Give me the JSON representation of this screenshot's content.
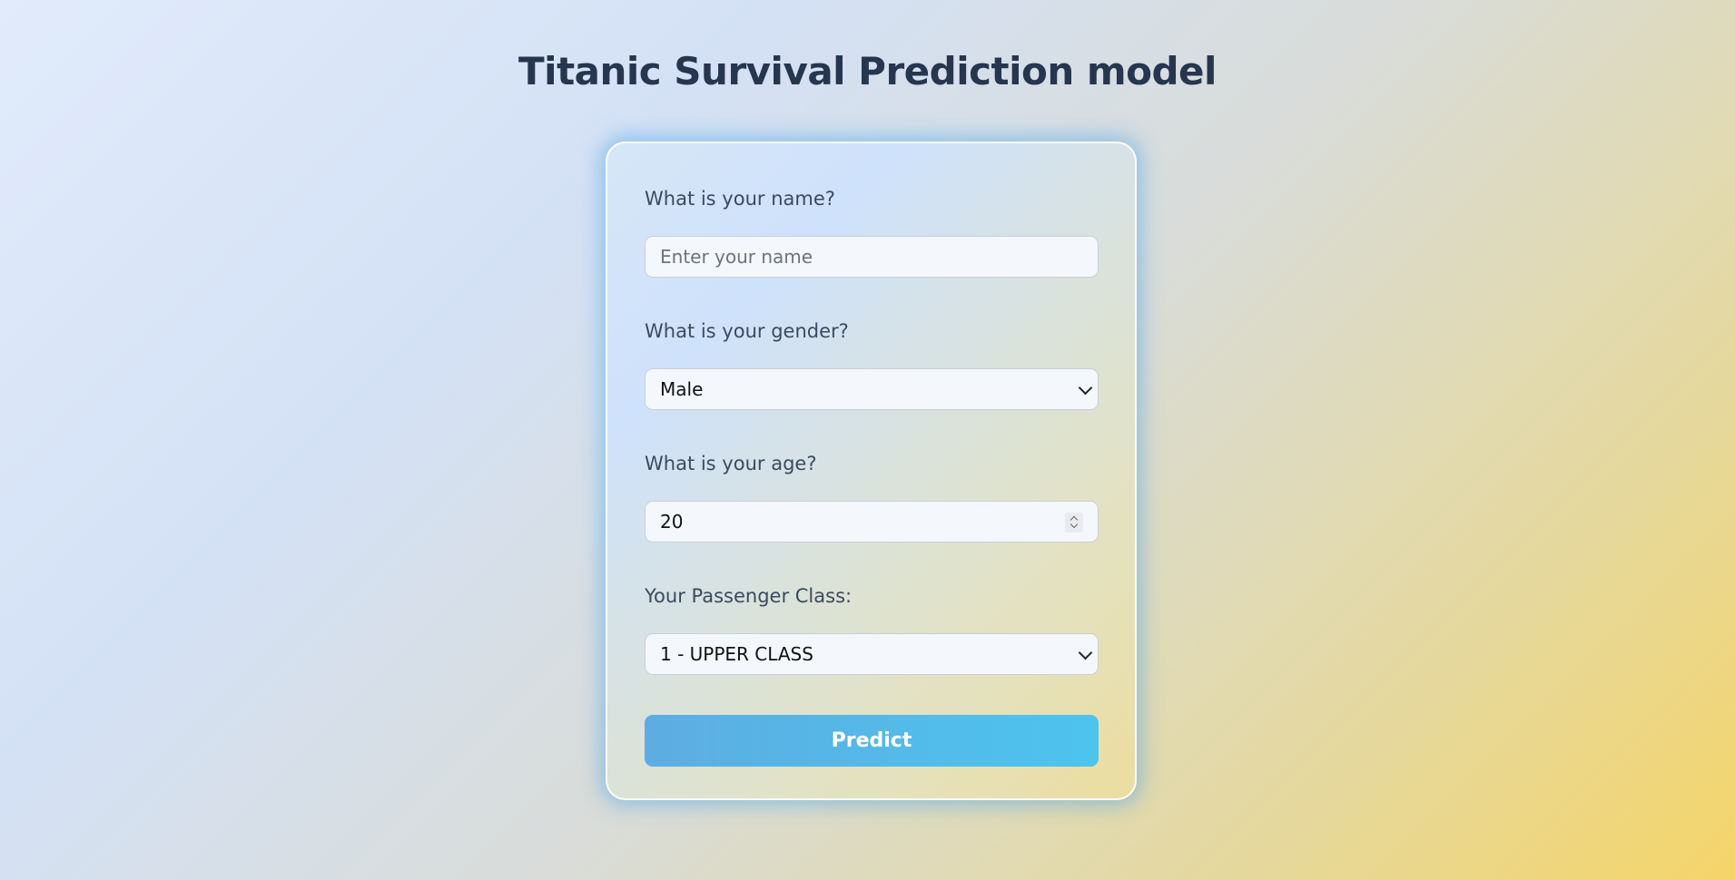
{
  "page": {
    "title": "Titanic Survival Prediction model"
  },
  "form": {
    "name": {
      "label": "What is your name?",
      "placeholder": "Enter your name",
      "value": ""
    },
    "gender": {
      "label": "What is your gender?",
      "selected": "Male"
    },
    "age": {
      "label": "What is your age?",
      "value": "20"
    },
    "passenger_class": {
      "label": "Your Passenger Class:",
      "selected": "1 - UPPER CLASS"
    },
    "submit_label": "Predict"
  },
  "colors": {
    "title": "#26364f",
    "button_start": "#5dade2",
    "button_end": "#4cc4ee",
    "card_glow": "#57aae6"
  }
}
